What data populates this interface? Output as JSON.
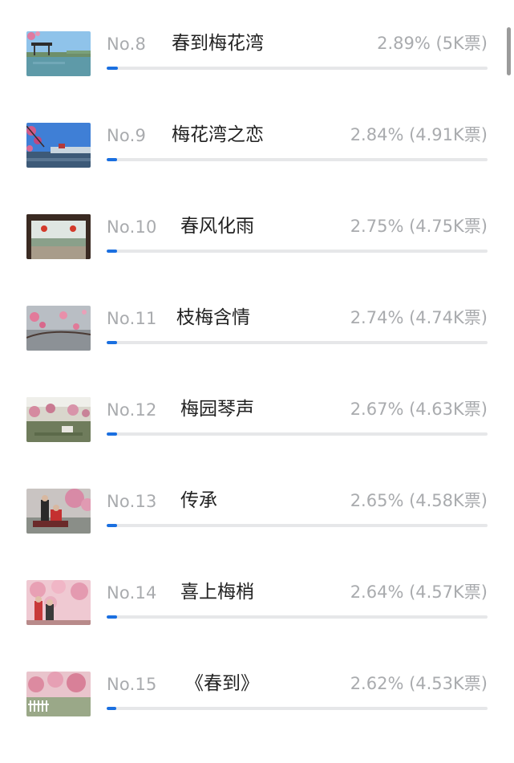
{
  "entries": [
    {
      "rank": "No.8",
      "title": "春到梅花湾",
      "stat": "2.89% (5K票)",
      "percent": 2.89,
      "thumb": "lake-pavilion-photo"
    },
    {
      "rank": "No.9",
      "title": "梅花湾之恋",
      "stat": "2.84% (4.91K票)",
      "percent": 2.84,
      "thumb": "blossom-sky-photo"
    },
    {
      "rank": "No.10",
      "title": "春风化雨",
      "stat": "2.75% (4.75K票)",
      "percent": 2.75,
      "thumb": "corridor-lanterns-photo"
    },
    {
      "rank": "No.11",
      "title": "枝梅含情",
      "stat": "2.74% (4.74K票)",
      "percent": 2.74,
      "thumb": "plum-branch-photo"
    },
    {
      "rank": "No.12",
      "title": "梅园琴声",
      "stat": "2.67% (4.63K票)",
      "percent": 2.67,
      "thumb": "garden-zither-photo"
    },
    {
      "rank": "No.13",
      "title": "传承",
      "stat": "2.65% (4.58K票)",
      "percent": 2.65,
      "thumb": "performers-photo"
    },
    {
      "rank": "No.14",
      "title": "喜上梅梢",
      "stat": "2.64% (4.57K票)",
      "percent": 2.64,
      "thumb": "blossom-couple-photo"
    },
    {
      "rank": "No.15",
      "title": "《春到》",
      "stat": "2.62% (4.53K票)",
      "percent": 2.62,
      "thumb": "blossom-fence-photo"
    }
  ],
  "colors": {
    "accent": "#1a6fe0",
    "track": "#e6e7e9",
    "muted_text": "#a9abae",
    "title_text": "#222222"
  }
}
